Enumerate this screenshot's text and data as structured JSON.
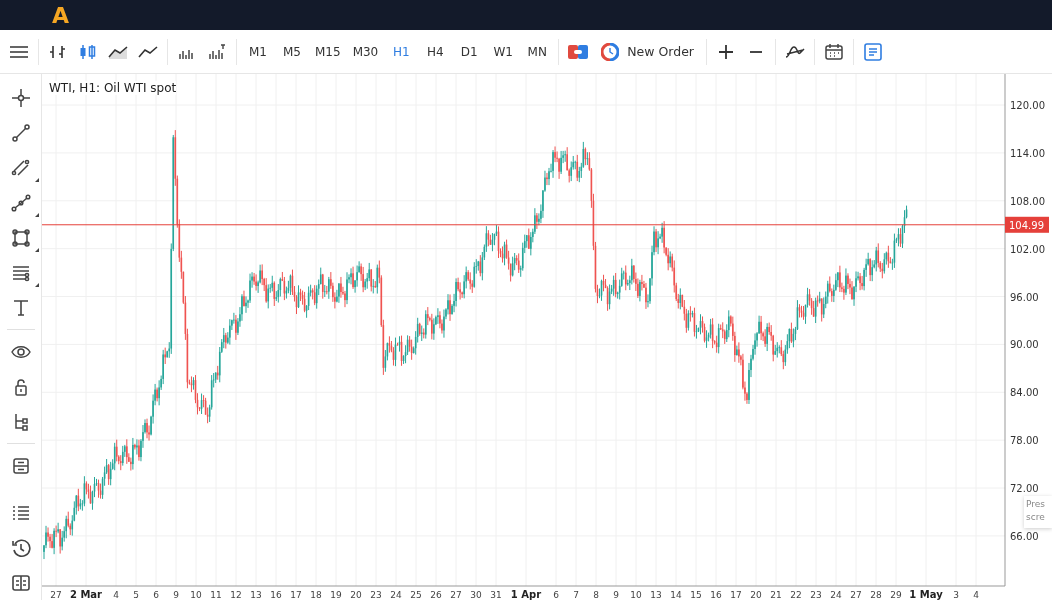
{
  "app": {
    "logo": "A"
  },
  "toolbar": {
    "chart_types": [
      {
        "kind": "bars",
        "selected": false
      },
      {
        "kind": "candles",
        "selected": true
      },
      {
        "kind": "area",
        "selected": false
      },
      {
        "kind": "line",
        "selected": false
      }
    ],
    "volume_tools": [
      {
        "kind": "volume"
      },
      {
        "kind": "tick-volume"
      }
    ],
    "timeframes": [
      {
        "label": "M1",
        "selected": false
      },
      {
        "label": "M5",
        "selected": false
      },
      {
        "label": "M15",
        "selected": false
      },
      {
        "label": "M30",
        "selected": false
      },
      {
        "label": "H1",
        "selected": true
      },
      {
        "label": "H4",
        "selected": false
      },
      {
        "label": "D1",
        "selected": false
      },
      {
        "label": "W1",
        "selected": false
      },
      {
        "label": "MN",
        "selected": false
      }
    ],
    "new_order": "New Order",
    "notes_active": true
  },
  "sidebar": {
    "tool_groups": [
      [
        {
          "kind": "crosshair",
          "submenu": false
        },
        {
          "kind": "trend-line",
          "submenu": false
        },
        {
          "kind": "channel",
          "submenu": true
        },
        {
          "kind": "polyline",
          "submenu": true
        },
        {
          "kind": "rectangle",
          "submenu": true
        },
        {
          "kind": "fibonacci",
          "submenu": true
        },
        {
          "kind": "text",
          "submenu": false
        }
      ],
      [
        {
          "kind": "eye",
          "submenu": false
        },
        {
          "kind": "lock",
          "submenu": false
        },
        {
          "kind": "tree",
          "submenu": false
        }
      ],
      [
        {
          "kind": "layers",
          "submenu": false
        }
      ]
    ],
    "bottom_tools": [
      {
        "kind": "list"
      },
      {
        "kind": "history"
      },
      {
        "kind": "book"
      }
    ]
  },
  "chart": {
    "title": "WTI, H1: Oil WTI spot",
    "price_ticks": [
      "120.00",
      "114.00",
      "108.00",
      "102.00",
      "96.00",
      "90.00",
      "84.00",
      "78.00",
      "72.00",
      "66.00"
    ],
    "current_price": "104.99",
    "time_labels": [
      {
        "label": "27",
        "kind": "day"
      },
      {
        "label": "2 Mar",
        "kind": "month"
      },
      {
        "label": "4",
        "kind": "day"
      },
      {
        "label": "5",
        "kind": "day"
      },
      {
        "label": "6",
        "kind": "day"
      },
      {
        "label": "9",
        "kind": "day"
      },
      {
        "label": "10",
        "kind": "day"
      },
      {
        "label": "11",
        "kind": "day"
      },
      {
        "label": "12",
        "kind": "day"
      },
      {
        "label": "13",
        "kind": "day"
      },
      {
        "label": "16",
        "kind": "day"
      },
      {
        "label": "17",
        "kind": "day"
      },
      {
        "label": "18",
        "kind": "day"
      },
      {
        "label": "19",
        "kind": "day"
      },
      {
        "label": "20",
        "kind": "day"
      },
      {
        "label": "23",
        "kind": "day"
      },
      {
        "label": "24",
        "kind": "day"
      },
      {
        "label": "25",
        "kind": "day"
      },
      {
        "label": "26",
        "kind": "day"
      },
      {
        "label": "27",
        "kind": "day"
      },
      {
        "label": "30",
        "kind": "day"
      },
      {
        "label": "31",
        "kind": "day"
      },
      {
        "label": "1 Apr",
        "kind": "month"
      },
      {
        "label": "6",
        "kind": "day"
      },
      {
        "label": "7",
        "kind": "day"
      },
      {
        "label": "8",
        "kind": "day"
      },
      {
        "label": "9",
        "kind": "day"
      },
      {
        "label": "10",
        "kind": "day"
      },
      {
        "label": "13",
        "kind": "day"
      },
      {
        "label": "14",
        "kind": "day"
      },
      {
        "label": "15",
        "kind": "day"
      },
      {
        "label": "16",
        "kind": "day"
      },
      {
        "label": "17",
        "kind": "day"
      },
      {
        "label": "20",
        "kind": "day"
      },
      {
        "label": "21",
        "kind": "day"
      },
      {
        "label": "22",
        "kind": "day"
      },
      {
        "label": "23",
        "kind": "day"
      },
      {
        "label": "24",
        "kind": "day"
      },
      {
        "label": "27",
        "kind": "day"
      },
      {
        "label": "28",
        "kind": "day"
      },
      {
        "label": "29",
        "kind": "day"
      },
      {
        "label": "1 May",
        "kind": "month"
      },
      {
        "label": "3",
        "kind": "day"
      },
      {
        "label": "4",
        "kind": "day"
      }
    ],
    "tooltip": [
      "Pres",
      "scre"
    ]
  }
}
